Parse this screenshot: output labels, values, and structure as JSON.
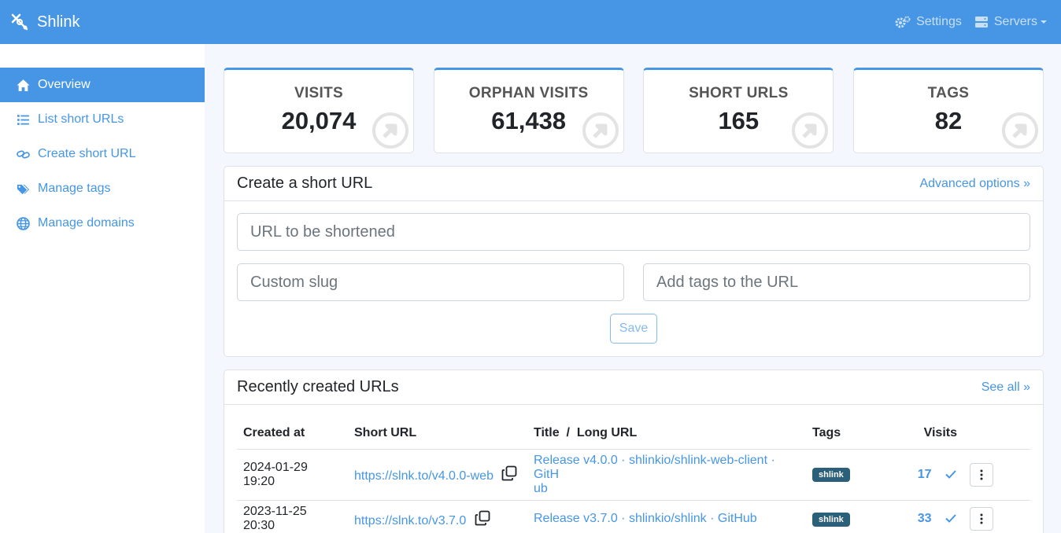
{
  "header": {
    "brand": "Shlink",
    "settings_label": "Settings",
    "servers_label": "Servers"
  },
  "sidebar": {
    "items": [
      {
        "label": "Overview",
        "icon": "home-icon",
        "active": true
      },
      {
        "label": "List short URLs",
        "icon": "list-icon"
      },
      {
        "label": "Create short URL",
        "icon": "link-icon"
      },
      {
        "label": "Manage tags",
        "icon": "tags-icon"
      },
      {
        "label": "Manage domains",
        "icon": "globe-icon"
      }
    ]
  },
  "stats": [
    {
      "title": "VISITS",
      "value": "20,074"
    },
    {
      "title": "ORPHAN VISITS",
      "value": "61,438"
    },
    {
      "title": "SHORT URLS",
      "value": "165"
    },
    {
      "title": "TAGS",
      "value": "82"
    }
  ],
  "create": {
    "title": "Create a short URL",
    "advanced_link": "Advanced options »",
    "url_placeholder": "URL to be shortened",
    "slug_placeholder": "Custom slug",
    "tags_placeholder": "Add tags to the URL",
    "save_label": "Save"
  },
  "recent": {
    "title": "Recently created URLs",
    "see_all": "See all »",
    "columns": [
      "Created at",
      "Short URL",
      "Title  /  Long URL",
      "Tags",
      "Visits"
    ],
    "rows": [
      {
        "created": "2024-01-29 19:20",
        "short_url": "https://slnk.to/v4.0.0-web",
        "title_line1": "Release v4.0.0 · shlinkio/shlink-web-client · GitH",
        "title_line2": "ub",
        "tag": "shlink",
        "visits": "17"
      },
      {
        "created": "2023-11-25 20:30",
        "short_url": "https://slnk.to/v3.7.0",
        "title_line1": "Release v3.7.0 · shlinkio/shlink · GitHub",
        "title_line2": "",
        "tag": "shlink",
        "visits": "33"
      }
    ]
  },
  "colors": {
    "primary": "#4696e5",
    "tag": "#2c5f79",
    "background": "#f5f7fe"
  }
}
